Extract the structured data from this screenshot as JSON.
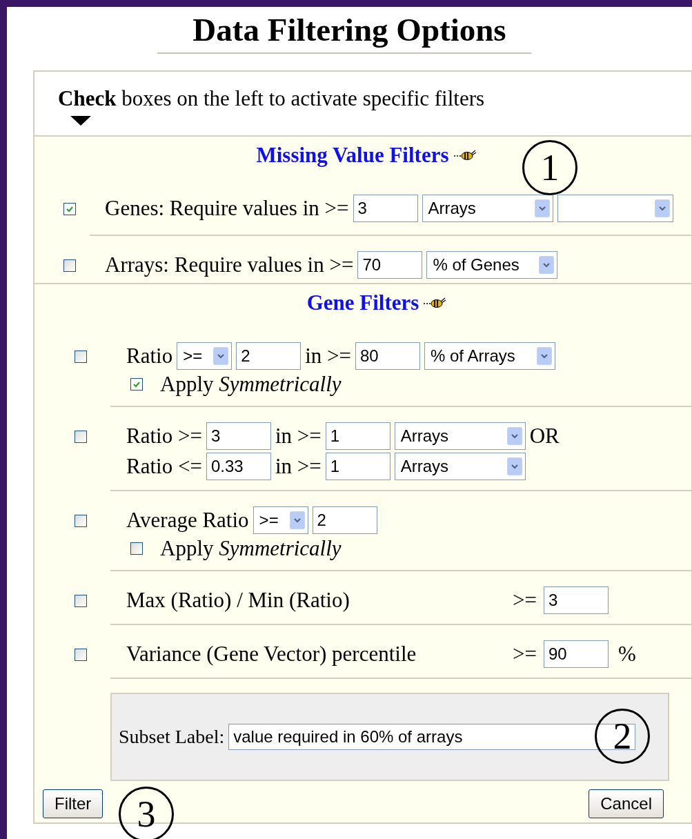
{
  "title": "Data Filtering Options",
  "instruction": "**Check** boxes on the left to activate specific filters",
  "sections": [
    {
      "heading": "Missing Value Filters",
      "filters": [
        {
          "kind": "parts",
          "checked": true,
          "lines": [
            [
              {
                "kind": "text",
                "text": "Genes: Require values in >="
              },
              {
                "kind": "input",
                "value": "3"
              },
              {
                "kind": "select",
                "value": "Arrays"
              },
              {
                "kind": "select"
              }
            ]
          ]
        },
        {
          "kind": "parts",
          "checked": false,
          "lines": [
            [
              {
                "kind": "text",
                "text": "Arrays: Require values in >="
              },
              {
                "kind": "input",
                "value": "70"
              },
              {
                "kind": "select",
                "value": "% of Genes"
              }
            ]
          ]
        }
      ]
    },
    {
      "heading": "Gene Filters",
      "filters": [
        {
          "kind": "parts",
          "checked": false,
          "lines": [
            [
              {
                "kind": "text",
                "text": "Ratio"
              },
              {
                "kind": "select",
                "value": ">="
              },
              {
                "kind": "input",
                "value": "2"
              },
              {
                "kind": "text",
                "text": "in >="
              },
              {
                "kind": "input",
                "value": "80"
              },
              {
                "kind": "select",
                "value": "% of Arrays"
              }
            ]
          ],
          "apply": {
            "checked": true,
            "label": "Apply *Symmetrically*"
          }
        },
        {
          "kind": "parts",
          "checked": false,
          "lines": [
            [
              {
                "kind": "text",
                "text": "Ratio >="
              },
              {
                "kind": "input",
                "value": "3"
              },
              {
                "kind": "text",
                "text": "in >="
              },
              {
                "kind": "input",
                "value": "1"
              },
              {
                "kind": "select",
                "value": "Arrays"
              },
              {
                "kind": "text",
                "text": "OR"
              }
            ],
            [
              {
                "kind": "text",
                "text": "Ratio <="
              },
              {
                "kind": "input",
                "value": "0.33"
              },
              {
                "kind": "text",
                "text": "in >="
              },
              {
                "kind": "input",
                "value": "1"
              },
              {
                "kind": "select",
                "value": "Arrays"
              }
            ]
          ]
        },
        {
          "kind": "parts",
          "checked": false,
          "lines": [
            [
              {
                "kind": "text",
                "text": "Average Ratio"
              },
              {
                "kind": "select",
                "value": ">="
              },
              {
                "kind": "input",
                "value": "2"
              }
            ]
          ],
          "apply": {
            "checked": false,
            "label": "Apply *Symmetrically*"
          }
        },
        {
          "kind": "threshold",
          "checked": false,
          "label": "Max (Ratio) / Min (Ratio)",
          "operator": ">=",
          "value": "3"
        },
        {
          "kind": "threshold",
          "checked": false,
          "label": "Variance (Gene Vector) percentile",
          "operator": ">=",
          "value": "90",
          "unit": "%"
        }
      ]
    }
  ],
  "subset": {
    "label": "Subset Label:",
    "value": "value required in 60% of arrays"
  },
  "buttons": [
    "Filter",
    "Cancel"
  ],
  "callouts": [
    "1",
    "2",
    "3"
  ]
}
